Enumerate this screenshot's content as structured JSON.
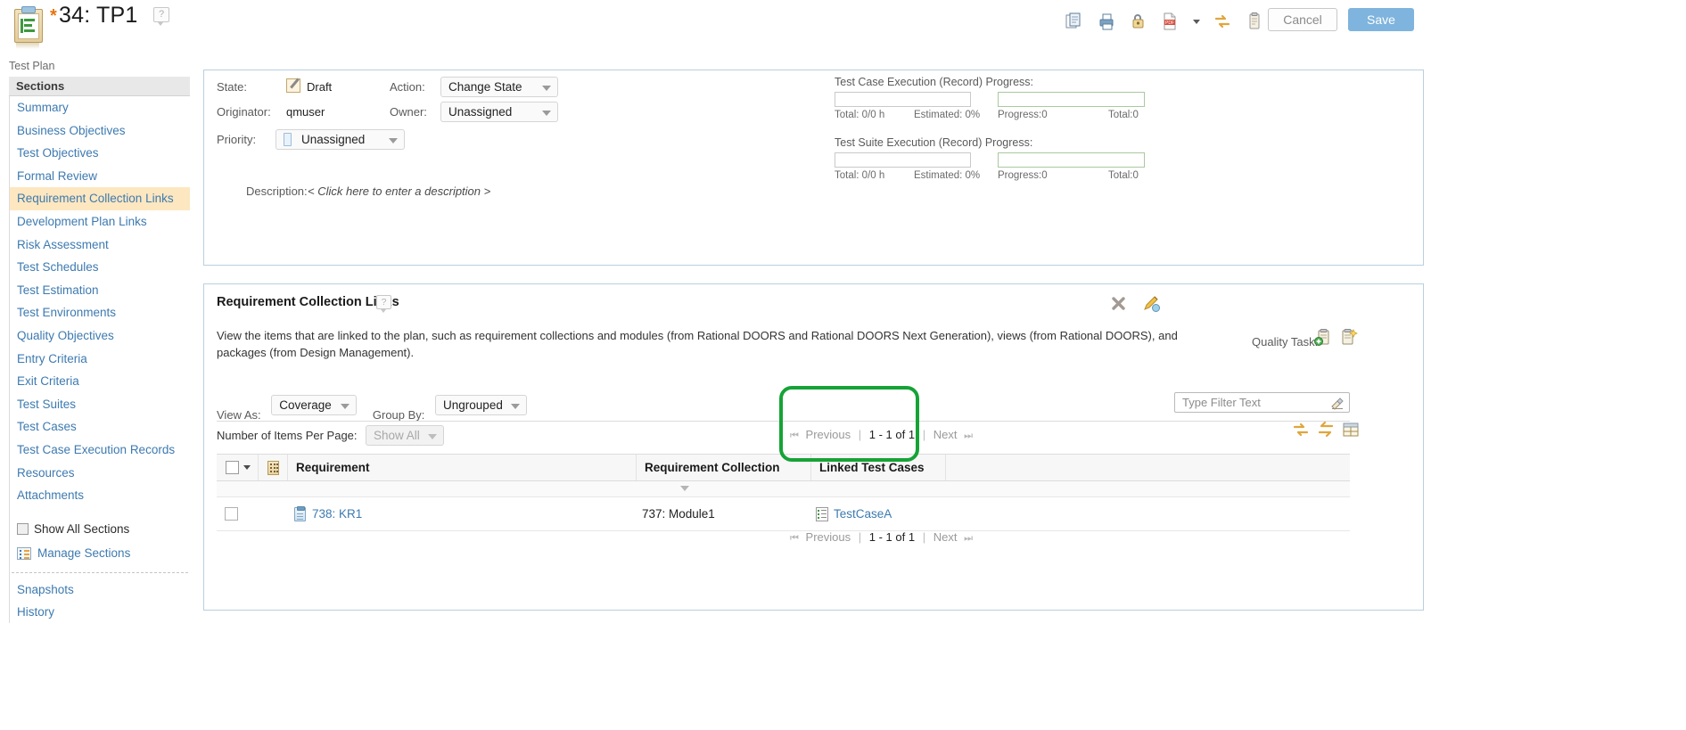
{
  "header": {
    "dirty_marker": "*",
    "title": "34: TP1",
    "help": "?",
    "subtitle": "Test Plan",
    "doc_icon": "test-plan-icon",
    "tools": [
      {
        "name": "copy-icon",
        "label": "Copy"
      },
      {
        "name": "print-icon",
        "label": "Print"
      },
      {
        "name": "lock-icon",
        "label": "Lock"
      },
      {
        "name": "pdf-icon",
        "label": "Export PDF"
      },
      {
        "name": "refresh-icon",
        "label": "Refresh"
      },
      {
        "name": "clipboard-icon",
        "label": "Clipboard"
      }
    ],
    "cancel_label": "Cancel",
    "save_label": "Save"
  },
  "sidebar": {
    "heading": "Sections",
    "items": [
      {
        "label": "Summary",
        "active": false
      },
      {
        "label": "Business Objectives",
        "active": false
      },
      {
        "label": "Test Objectives",
        "active": false
      },
      {
        "label": "Formal Review",
        "active": false
      },
      {
        "label": "Requirement Collection Links",
        "active": true
      },
      {
        "label": "Development Plan Links",
        "active": false
      },
      {
        "label": "Risk Assessment",
        "active": false
      },
      {
        "label": "Test Schedules",
        "active": false
      },
      {
        "label": "Test Estimation",
        "active": false
      },
      {
        "label": "Test Environments",
        "active": false
      },
      {
        "label": "Quality Objectives",
        "active": false
      },
      {
        "label": "Entry Criteria",
        "active": false
      },
      {
        "label": "Exit Criteria",
        "active": false
      },
      {
        "label": "Test Suites",
        "active": false
      },
      {
        "label": "Test Cases",
        "active": false
      },
      {
        "label": "Test Case Execution Records",
        "active": false
      },
      {
        "label": "Resources",
        "active": false
      },
      {
        "label": "Attachments",
        "active": false
      }
    ],
    "show_all_sections": "Show All Sections",
    "show_all_checked": false,
    "manage_sections": "Manage Sections",
    "bottom_links": [
      "Snapshots",
      "History"
    ]
  },
  "summary": {
    "state_label": "State:",
    "state_value": "Draft",
    "originator_label": "Originator:",
    "originator_value": "qmuser",
    "priority_label": "Priority:",
    "priority_value": "Unassigned",
    "action_label": "Action:",
    "action_value": "Change State",
    "owner_label": "Owner:",
    "owner_value": "Unassigned",
    "description_label": "Description:",
    "description_value": "< Click here to enter a description >",
    "progress": [
      {
        "title": "Test Case Execution (Record) Progress:",
        "left_total": "Total: 0/0 h",
        "left_estimated": "Estimated: 0%",
        "right_progress": "Progress:0",
        "right_total": "Total:0"
      },
      {
        "title": "Test Suite Execution (Record) Progress:",
        "left_total": "Total: 0/0 h",
        "left_estimated": "Estimated: 0%",
        "right_progress": "Progress:0",
        "right_total": "Total:0"
      }
    ]
  },
  "section": {
    "title": "Requirement Collection Links",
    "help": "?",
    "description": "View the items that are linked to the plan, such as requirement collections and modules (from Rational DOORS and Rational DOORS Next Generation), views (from Rational DOORS), and packages (from Design Management).",
    "close_icon": "close-icon",
    "edit_icon": "edit-pencil-icon",
    "quality_task_label": "Quality Task:",
    "quality_task_icons": [
      "add-quality-task-icon",
      "new-quality-task-icon"
    ],
    "view_as_label": "View As:",
    "view_as_value": "Coverage",
    "group_by_label": "Group By:",
    "group_by_value": "Ungrouped",
    "filter_placeholder": "Type Filter Text",
    "filter_value": "",
    "filter_icon": "filter-icon",
    "items_per_page_label": "Number of Items Per Page:",
    "items_per_page_value": "Show All",
    "pager": {
      "first_icon": "first-page-icon",
      "previous": "Previous",
      "range": "1 - 1 of 1",
      "next": "Next",
      "last_icon": "last-page-icon",
      "sep": "|"
    },
    "table_tools": [
      {
        "name": "refresh-icon"
      },
      {
        "name": "swap-arrows-icon"
      },
      {
        "name": "configure-columns-icon"
      }
    ]
  },
  "table": {
    "columns": [
      "Requirement",
      "Requirement Collection",
      "Linked Test Cases"
    ],
    "header_checkbox_checked": false,
    "rows": [
      {
        "checked": false,
        "requirement": "738: KR1",
        "requirement_collection": "737: Module1",
        "linked_test_cases": "TestCaseA"
      }
    ]
  },
  "annotation": {
    "color": "#16a336",
    "target": "Linked Test Cases"
  }
}
